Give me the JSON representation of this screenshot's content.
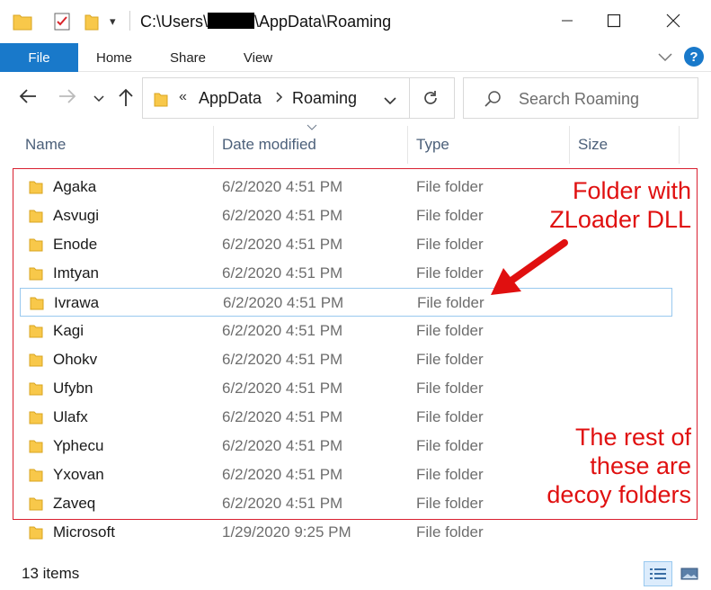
{
  "window": {
    "title_prefix": "C:\\Users\\",
    "title_suffix": "\\AppData\\Roaming"
  },
  "ribbon": {
    "tabs": [
      "File",
      "Home",
      "Share",
      "View"
    ],
    "help": "?"
  },
  "address": {
    "overflow": "«",
    "segments": [
      "AppData",
      "Roaming"
    ]
  },
  "search": {
    "placeholder": "Search Roaming"
  },
  "columns": [
    "Name",
    "Date modified",
    "Type",
    "Size"
  ],
  "files": [
    {
      "name": "Agaka",
      "date": "6/2/2020 4:51 PM",
      "type": "File folder"
    },
    {
      "name": "Asvugi",
      "date": "6/2/2020 4:51 PM",
      "type": "File folder"
    },
    {
      "name": "Enode",
      "date": "6/2/2020 4:51 PM",
      "type": "File folder"
    },
    {
      "name": "Imtyan",
      "date": "6/2/2020 4:51 PM",
      "type": "File folder"
    },
    {
      "name": "Ivrawa",
      "date": "6/2/2020 4:51 PM",
      "type": "File folder",
      "selected": true
    },
    {
      "name": "Kagi",
      "date": "6/2/2020 4:51 PM",
      "type": "File folder"
    },
    {
      "name": "Ohokv",
      "date": "6/2/2020 4:51 PM",
      "type": "File folder"
    },
    {
      "name": "Ufybn",
      "date": "6/2/2020 4:51 PM",
      "type": "File folder"
    },
    {
      "name": "Ulafx",
      "date": "6/2/2020 4:51 PM",
      "type": "File folder"
    },
    {
      "name": "Yphecu",
      "date": "6/2/2020 4:51 PM",
      "type": "File folder"
    },
    {
      "name": "Yxovan",
      "date": "6/2/2020 4:51 PM",
      "type": "File folder"
    },
    {
      "name": "Zaveq",
      "date": "6/2/2020 4:51 PM",
      "type": "File folder"
    },
    {
      "name": "Microsoft",
      "date": "1/29/2020 9:25 PM",
      "type": "File folder"
    }
  ],
  "annotations": {
    "malicious": [
      "Folder with",
      "ZLoader DLL"
    ],
    "decoy": [
      "The rest of",
      "these are",
      "decoy folders"
    ]
  },
  "status": {
    "item_count": "13 items"
  },
  "colors": {
    "accent": "#1979ca",
    "annotation": "#e01010",
    "folder": "#f8c84a",
    "header_text": "#4c607a"
  }
}
